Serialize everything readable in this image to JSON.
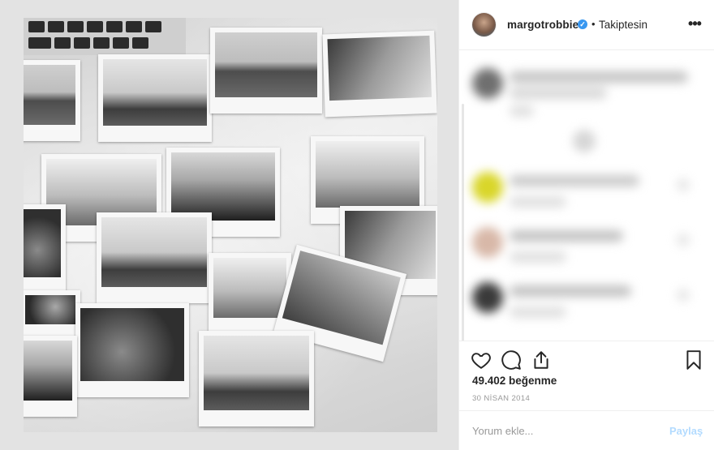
{
  "post": {
    "username": "margotrobbie",
    "separator": "•",
    "follow_label": "Takiptesin",
    "more_label": "•••",
    "likes_label": "49.402 beğenme",
    "date_label": "30 NİSAN 2014"
  },
  "comment_box": {
    "placeholder": "Yorum ekle...",
    "share_label": "Paylaş"
  },
  "icons": {
    "verified": "verified-badge-icon",
    "like": "heart-icon",
    "comment": "speech-bubble-icon",
    "share": "share-icon",
    "save": "bookmark-icon",
    "more": "more-options-icon"
  },
  "colors": {
    "verified_blue": "#3897f0",
    "share_disabled": "#b3dbff",
    "muted_text": "#999999"
  }
}
